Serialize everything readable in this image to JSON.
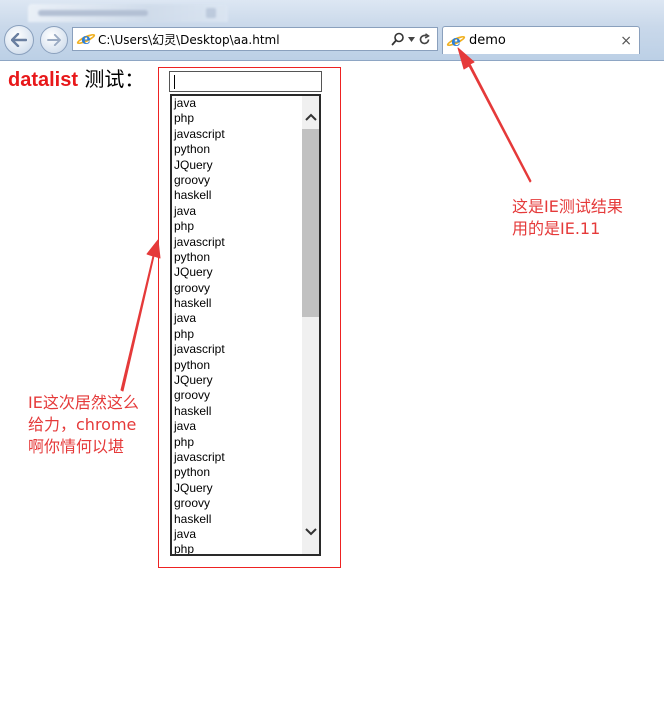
{
  "browser": {
    "address": "C:\\Users\\幻灵\\Desktop\\aa.html",
    "tab_title": "demo",
    "tab_close": "×",
    "icons": [
      "back-arrow-icon",
      "forward-arrow-icon",
      "ie-page-icon",
      "search-icon",
      "dropdown-arrow-icon",
      "refresh-icon",
      "close-icon"
    ]
  },
  "page": {
    "label_strong": "datalist",
    "label_text": "测试：",
    "input_value": "",
    "options": [
      "java",
      "php",
      "javascript",
      "python",
      "JQuery",
      "groovy",
      "haskell",
      "java",
      "php",
      "javascript",
      "python",
      "JQuery",
      "groovy",
      "haskell",
      "java",
      "php",
      "javascript",
      "python",
      "JQuery",
      "groovy",
      "haskell",
      "java",
      "php",
      "javascript",
      "python",
      "JQuery",
      "groovy",
      "haskell",
      "java",
      "php"
    ]
  },
  "annotations": {
    "left": [
      "IE这次居然这么",
      "给力，chrome",
      "啊你情何以堪"
    ],
    "right": [
      "这是IE测试结果",
      "用的是IE.11"
    ]
  },
  "colors": {
    "annotation": "#e53a3a",
    "highlight_border": "#ee2222",
    "label_strong": "#e8181a"
  }
}
